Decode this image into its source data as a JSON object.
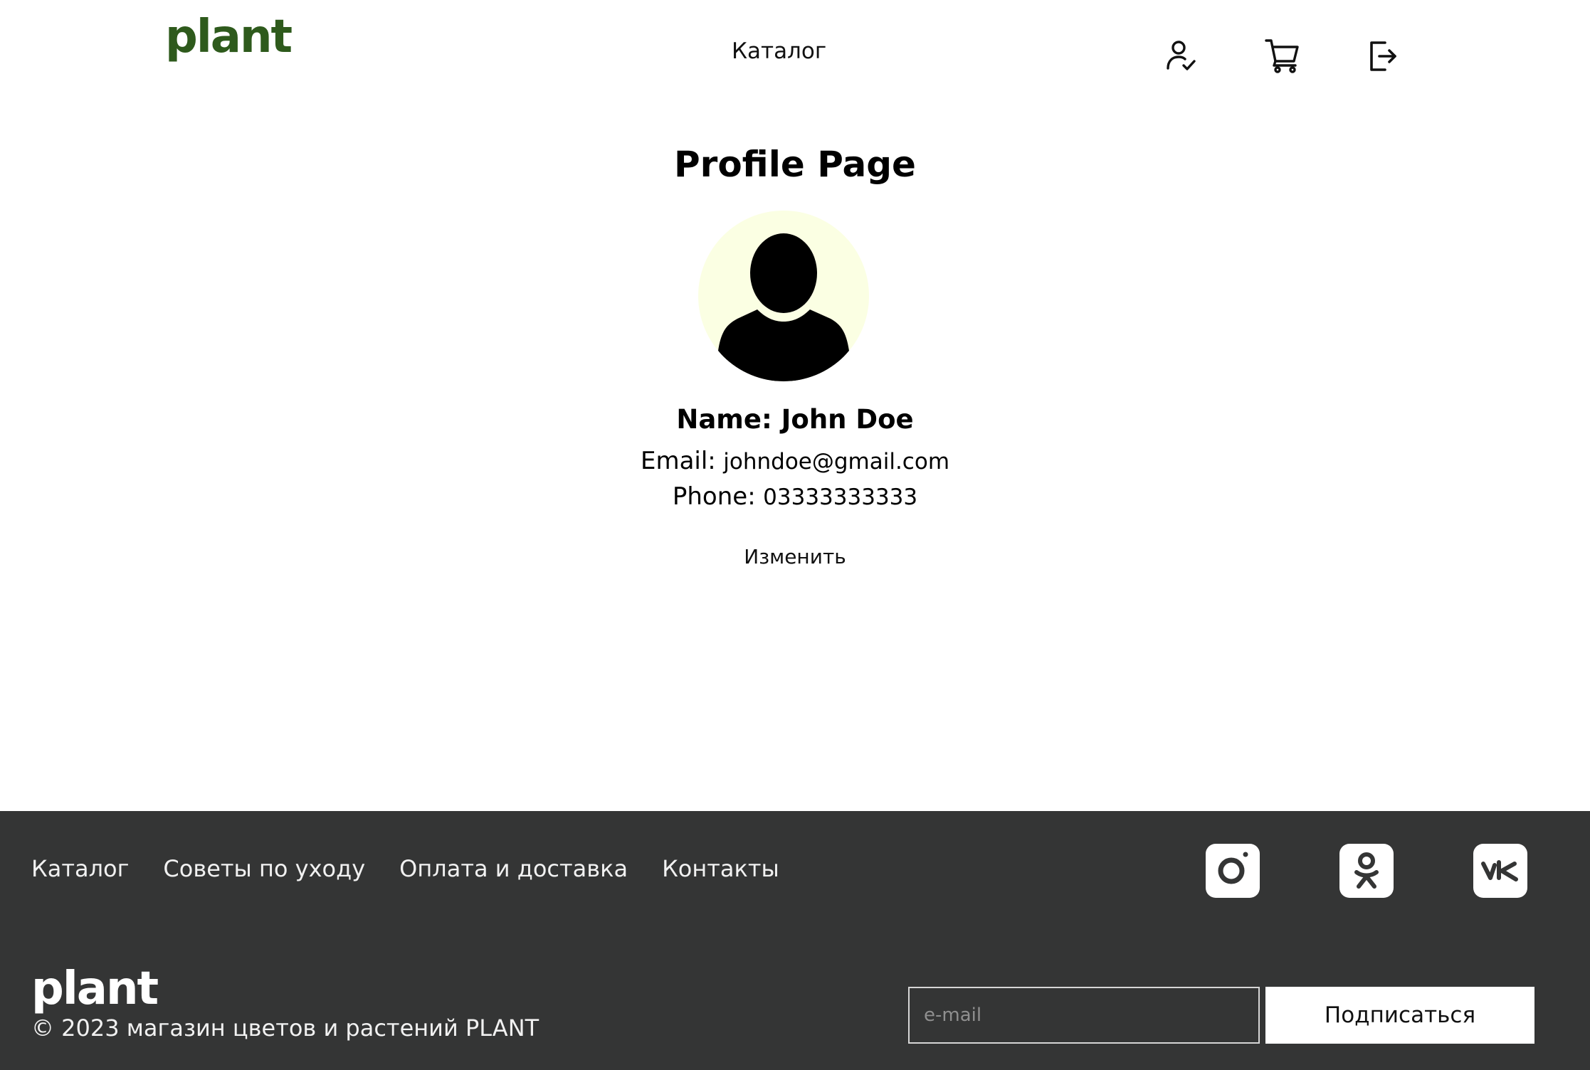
{
  "header": {
    "logo": "plant",
    "nav_catalog": "Каталог",
    "icons": [
      "profile-check-icon",
      "cart-icon",
      "logout-icon"
    ]
  },
  "profile": {
    "title": "Profile Page",
    "name_text": "Name: John Doe",
    "email_label": "Email:",
    "email_value": "johndoe@gmail.com",
    "phone_label": "Phone:",
    "phone_value": "03333333333",
    "edit_label": "Изменить"
  },
  "footer": {
    "links": [
      "Каталог",
      "Советы по уходу",
      "Оплата и доставка",
      "Контакты"
    ],
    "social": [
      "instagram-icon",
      "odnoklassniki-icon",
      "vk-icon"
    ],
    "logo": "plant",
    "copyright": "© 2023 магазин цветов и растений PLANT",
    "email_placeholder": "e-mail",
    "subscribe_label": "Подписаться"
  },
  "colors": {
    "brand_green": "#2e5a1c",
    "footer_bg": "#343535",
    "avatar_bg": "#fbffe3"
  }
}
